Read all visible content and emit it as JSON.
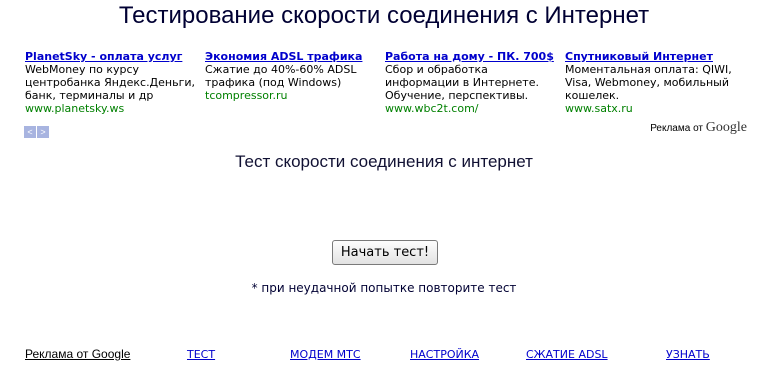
{
  "title": "Тестирование скорости соединения с Интернет",
  "ads": [
    {
      "head": "PlanetSky - оплата услуг",
      "body": "WebMoney по курсу центробанка Яндекс.Деньги, банк, терминалы и др",
      "url": "www.planetsky.ws"
    },
    {
      "head": "Экономия ADSL трафика",
      "body": "Сжатие до 40%-60% ADSL трафика (под Windows)",
      "url": "tcompressor.ru"
    },
    {
      "head": "Работа на дому - ПК. 700$",
      "body": "Сбор и обработка информации в Интернете. Обучение, перспективы.",
      "url": "www.wbc2t.com/"
    },
    {
      "head": "Спутниковый Интернет",
      "body": "Моментальная оплата: QIWI, Visa, Webmoney, мобильный кошелек.",
      "url": "www.satx.ru"
    }
  ],
  "nav": {
    "prev": "<",
    "next": ">"
  },
  "google_ads": {
    "prefix": "Реклама от",
    "brand": "Google"
  },
  "subtitle": "Тест скорости соединения с интернет",
  "start_button": "Начать тест!",
  "note": "* при неудачной попытке повторите тест",
  "footer": {
    "ads_label": "Реклама от Google",
    "links": [
      "ТЕСТ",
      "МОДЕМ МТС",
      "НАСТРОЙКА",
      "СЖАТИЕ ADSL",
      "УЗНАТЬ"
    ]
  }
}
